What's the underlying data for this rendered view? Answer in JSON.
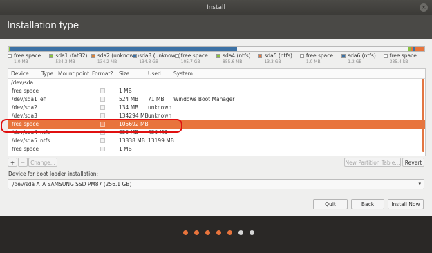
{
  "window": {
    "title": "Install",
    "close_glyph": "×"
  },
  "header": {
    "title": "Installation type"
  },
  "partition_bar": {
    "segments": [
      {
        "color": "#cfcfcf",
        "fraction": 0.002
      },
      {
        "color": "#8ac242",
        "fraction": 0.002
      },
      {
        "color": "#d9823b",
        "fraction": 0.001
      },
      {
        "color": "#3c71a5",
        "fraction": 0.545
      },
      {
        "color": "#f4f4f4",
        "fraction": 0.412
      },
      {
        "color": "#8ac242",
        "fraction": 0.004
      },
      {
        "color": "#e8743c",
        "fraction": 0.006
      },
      {
        "color": "#cfcfcf",
        "fraction": 0.002
      },
      {
        "color": "#3c71a5",
        "fraction": 0.004
      },
      {
        "color": "#e8743c",
        "fraction": 0.022
      }
    ]
  },
  "legend": [
    {
      "name": "free space",
      "size": "1.0 MB",
      "color": "#ffffff"
    },
    {
      "name": "sda1 (fat32)",
      "size": "524.3 MB",
      "color": "#8ac242"
    },
    {
      "name": "sda2 (unknown)",
      "size": "134.2 MB",
      "color": "#d9823b"
    },
    {
      "name": "sda3 (unknown)",
      "size": "134.3 GB",
      "color": "#3c71a5"
    },
    {
      "name": "free space",
      "size": "105.7 GB",
      "color": "#ffffff"
    },
    {
      "name": "sda4 (ntfs)",
      "size": "855.6 MB",
      "color": "#8ac242"
    },
    {
      "name": "sda5 (ntfs)",
      "size": "13.3 GB",
      "color": "#e8743c"
    },
    {
      "name": "free space",
      "size": "1.0 MB",
      "color": "#ffffff"
    },
    {
      "name": "sda6 (ntfs)",
      "size": "1.2 GB",
      "color": "#3c71a5"
    },
    {
      "name": "free space",
      "size": "335.4 kB",
      "color": "#ffffff"
    }
  ],
  "table": {
    "headers": {
      "device": "Device",
      "type": "Type",
      "mount": "Mount point",
      "format": "Format?",
      "size": "Size",
      "used": "Used",
      "system": "System"
    },
    "rows": [
      {
        "device": "/dev/sda",
        "type": "",
        "size": "",
        "used": "",
        "system": "",
        "checkbox": false
      },
      {
        "device": "free space",
        "type": "",
        "size": "1 MB",
        "used": "",
        "system": "",
        "checkbox": true
      },
      {
        "device": "/dev/sda1",
        "type": "efi",
        "size": "524 MB",
        "used": "71 MB",
        "system": "Windows Boot Manager",
        "checkbox": true
      },
      {
        "device": "/dev/sda2",
        "type": "",
        "size": "134 MB",
        "used": "unknown",
        "system": "",
        "checkbox": true
      },
      {
        "device": "/dev/sda3",
        "type": "",
        "size": "134294 MB",
        "used": "unknown",
        "system": "",
        "checkbox": true
      },
      {
        "device": "free space",
        "type": "",
        "size": "105692 MB",
        "used": "",
        "system": "",
        "checkbox": true,
        "selected": true
      },
      {
        "device": "/dev/sda4",
        "type": "ntfs",
        "size": "855 MB",
        "used": "430 MB",
        "system": "",
        "checkbox": true
      },
      {
        "device": "/dev/sda5",
        "type": "ntfs",
        "size": "13338 MB",
        "used": "13199 MB",
        "system": "",
        "checkbox": true
      },
      {
        "device": "free space",
        "type": "",
        "size": "1 MB",
        "used": "",
        "system": "",
        "checkbox": true
      }
    ]
  },
  "toolbar": {
    "add": "+",
    "remove": "−",
    "change": "Change...",
    "new_table": "New Partition Table...",
    "revert": "Revert"
  },
  "boot_loader": {
    "label": "Device for boot loader installation:",
    "value": "/dev/sda   ATA SAMSUNG SSD PM87 (256.1 GB)",
    "arrow": "▾"
  },
  "actions": {
    "quit": "Quit",
    "back": "Back",
    "install": "Install Now"
  },
  "progress": {
    "total_steps": 7,
    "active_steps": 5,
    "active_color": "#e8743c",
    "inactive_color": "#d6d6d6"
  }
}
